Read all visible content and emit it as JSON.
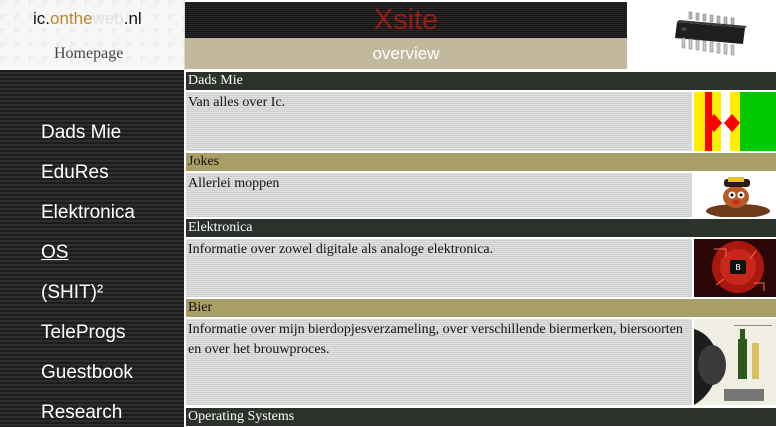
{
  "brand": {
    "name_part1": "ic.",
    "name_part2": "onthe",
    "name_part3": "web",
    "name_part4": ".nl",
    "homepage_label": "Homepage"
  },
  "header": {
    "title": "Xsite",
    "subtitle": "overview"
  },
  "nav": {
    "items": [
      {
        "label": "Dads Mie"
      },
      {
        "label": "EduRes"
      },
      {
        "label": "Elektronica"
      },
      {
        "label": "OS"
      },
      {
        "label": "(SHIT)²"
      },
      {
        "label": "TeleProgs"
      },
      {
        "label": "Guestbook"
      },
      {
        "label": "Research"
      }
    ]
  },
  "sections": [
    {
      "title": "Dads Mie",
      "description": "Van alles over Ic.",
      "thumb_icon": "flag-diamonds-icon"
    },
    {
      "title": "Jokes",
      "description": "Allerlei moppen",
      "thumb_icon": "cartoon-mole-icon"
    },
    {
      "title": "Elektronica",
      "description": "Informatie over zowel digitale als analoge elektronica.",
      "thumb_icon": "circuit-board-icon"
    },
    {
      "title": "Bier",
      "description": "Informatie over mijn bierdopjesverzameling, over verschillende biermerken, biersoorten en over het brouwproces.",
      "thumb_icon": "beer-drinker-icon"
    },
    {
      "title": "Operating Systems"
    }
  ],
  "colors": {
    "title_red": "#9a1a12",
    "overview_tan": "#c2b89e",
    "section_dark": "#2b322c",
    "section_tan": "#a89e66",
    "brand_gold": "#b58a2a"
  }
}
